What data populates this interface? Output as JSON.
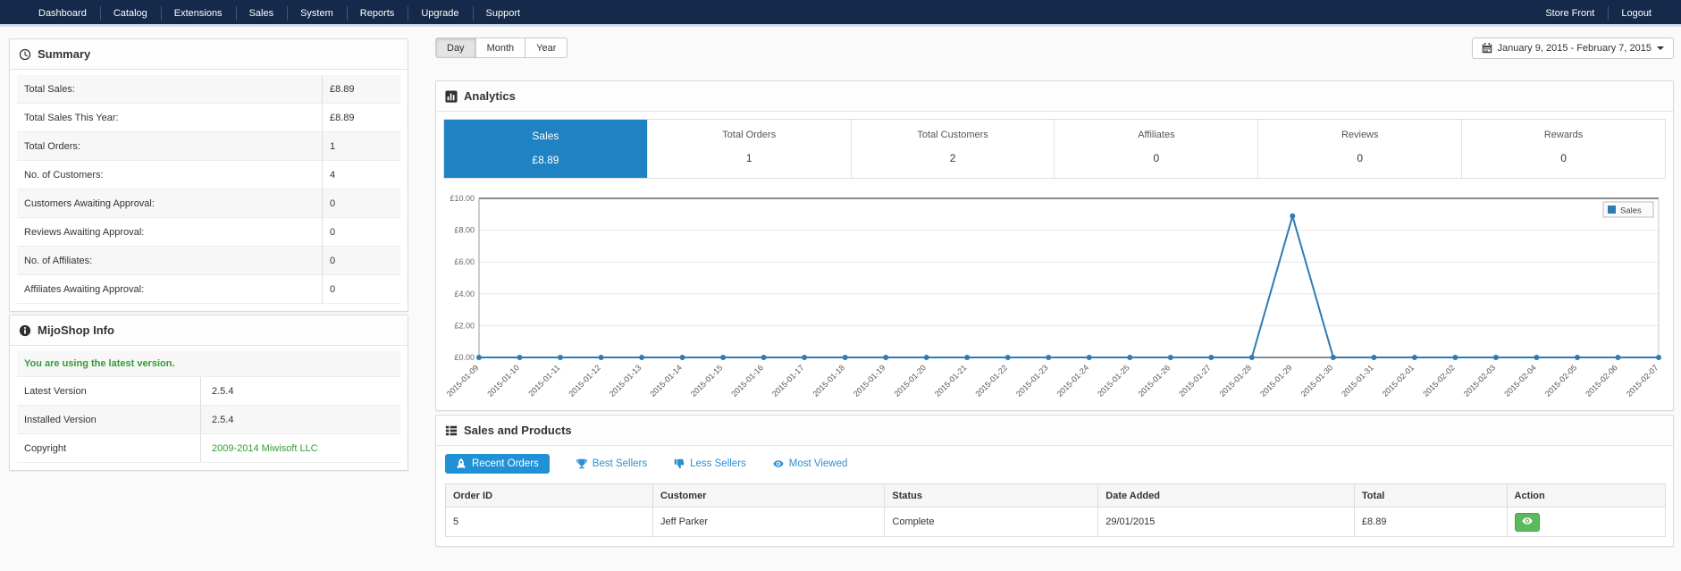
{
  "nav": {
    "items": [
      "Dashboard",
      "Catalog",
      "Extensions",
      "Sales",
      "System",
      "Reports",
      "Upgrade",
      "Support"
    ],
    "right_items": [
      "Store Front",
      "Logout"
    ]
  },
  "summary": {
    "title": "Summary",
    "rows": [
      {
        "label": "Total Sales:",
        "value": "£8.89"
      },
      {
        "label": "Total Sales This Year:",
        "value": "£8.89"
      },
      {
        "label": "Total Orders:",
        "value": "1"
      },
      {
        "label": "No. of Customers:",
        "value": "4"
      },
      {
        "label": "Customers Awaiting Approval:",
        "value": "0"
      },
      {
        "label": "Reviews Awaiting Approval:",
        "value": "0"
      },
      {
        "label": "No. of Affiliates:",
        "value": "0"
      },
      {
        "label": "Affiliates Awaiting Approval:",
        "value": "0"
      }
    ]
  },
  "info": {
    "title": "MijoShop Info",
    "status": "You are using the latest version.",
    "rows": [
      {
        "label": "Latest Version",
        "value": "2.5.4",
        "link": false
      },
      {
        "label": "Installed Version",
        "value": "2.5.4",
        "link": false
      },
      {
        "label": "Copyright",
        "value": "2009-2014 Miwisoft LLC",
        "link": true
      }
    ]
  },
  "toolbar": {
    "range_buttons": [
      "Day",
      "Month",
      "Year"
    ],
    "active_range": "Day",
    "date_range": "January 9, 2015 - February 7, 2015"
  },
  "analytics": {
    "title": "Analytics",
    "tabs": [
      {
        "label": "Sales",
        "value": "£8.89",
        "active": true
      },
      {
        "label": "Total Orders",
        "value": "1",
        "active": false
      },
      {
        "label": "Total Customers",
        "value": "2",
        "active": false
      },
      {
        "label": "Affiliates",
        "value": "0",
        "active": false
      },
      {
        "label": "Reviews",
        "value": "0",
        "active": false
      },
      {
        "label": "Rewards",
        "value": "0",
        "active": false
      }
    ]
  },
  "chart_data": {
    "type": "line",
    "title": "",
    "xlabel": "",
    "ylabel": "",
    "ylim": [
      0,
      10
    ],
    "yticks": [
      "£0.00",
      "£2.00",
      "£4.00",
      "£6.00",
      "£8.00",
      "£10.00"
    ],
    "grid": true,
    "legend_position": "top-right",
    "x": [
      "2015-01-09",
      "2015-01-10",
      "2015-01-11",
      "2015-01-12",
      "2015-01-13",
      "2015-01-14",
      "2015-01-15",
      "2015-01-16",
      "2015-01-17",
      "2015-01-18",
      "2015-01-19",
      "2015-01-20",
      "2015-01-21",
      "2015-01-22",
      "2015-01-23",
      "2015-01-24",
      "2015-01-25",
      "2015-01-26",
      "2015-01-27",
      "2015-01-28",
      "2015-01-29",
      "2015-01-30",
      "2015-01-31",
      "2015-02-01",
      "2015-02-02",
      "2015-02-03",
      "2015-02-04",
      "2015-02-05",
      "2015-02-06",
      "2015-02-07"
    ],
    "series": [
      {
        "name": "Sales",
        "color": "#2e7cb4",
        "values": [
          0,
          0,
          0,
          0,
          0,
          0,
          0,
          0,
          0,
          0,
          0,
          0,
          0,
          0,
          0,
          0,
          0,
          0,
          0,
          0,
          8.89,
          0,
          0,
          0,
          0,
          0,
          0,
          0,
          0,
          0
        ]
      }
    ]
  },
  "sales_products": {
    "title": "Sales and Products",
    "tabs": [
      {
        "label": "Recent Orders",
        "icon": "rocket-icon",
        "active": true
      },
      {
        "label": "Best Sellers",
        "icon": "trophy-icon",
        "active": false
      },
      {
        "label": "Less Sellers",
        "icon": "thumbs-down-icon",
        "active": false
      },
      {
        "label": "Most Viewed",
        "icon": "eye-icon",
        "active": false
      }
    ],
    "table": {
      "headers": [
        "Order ID",
        "Customer",
        "Status",
        "Date Added",
        "Total",
        "Action"
      ],
      "rows": [
        {
          "order_id": "5",
          "customer": "Jeff Parker",
          "status": "Complete",
          "date_added": "29/01/2015",
          "total": "£8.89"
        }
      ]
    }
  },
  "colors": {
    "navbar": "#15294a",
    "active_tab_blue": "#1f82c2",
    "button_blue": "#2191d6",
    "chart_line": "#2e7cb4",
    "success_green": "#5cb85c",
    "link_green": "#379b37"
  }
}
